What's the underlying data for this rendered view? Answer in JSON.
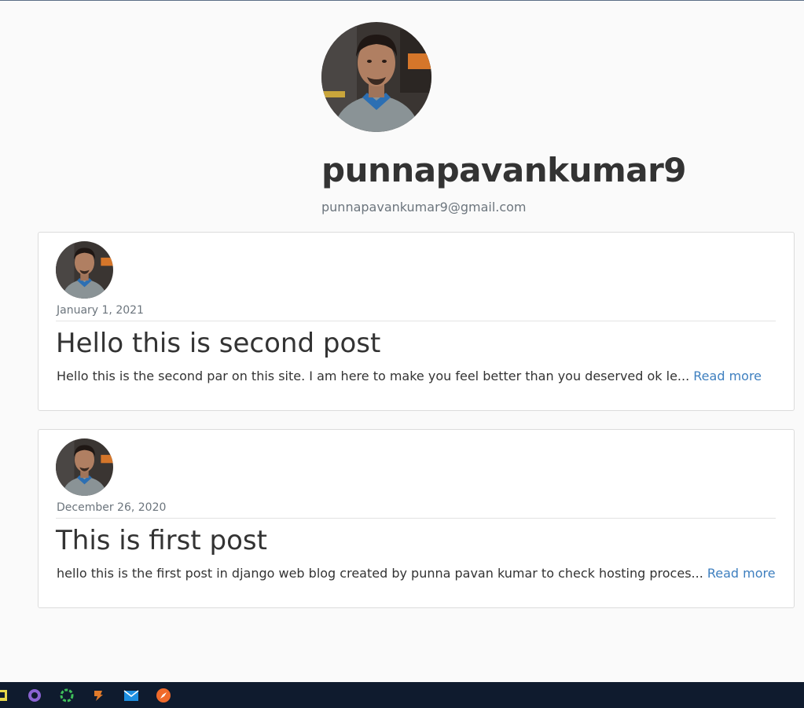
{
  "profile": {
    "username": "punnapavankumar9",
    "email": "punnapavankumar9@gmail.com"
  },
  "posts": [
    {
      "date": "January 1, 2021",
      "title": "Hello this is second post",
      "excerpt": "Hello this is the second par on this site. I am here to make you feel better than you deserved ok le...",
      "read_more": "Read more"
    },
    {
      "date": "December 26, 2020",
      "title": "This is first post",
      "excerpt": "hello this is the first post in django web blog created by punna pavan kumar to check hosting proces...",
      "read_more": "Read more"
    }
  ],
  "taskbar": {
    "icons": [
      "terminal-icon",
      "github-icon",
      "loading-icon",
      "file-manager-icon",
      "mail-icon",
      "compass-icon"
    ]
  },
  "colors": {
    "link": "#3e7fbf",
    "taskbar": "#0f1b2e",
    "page_background": "#fafafa"
  }
}
